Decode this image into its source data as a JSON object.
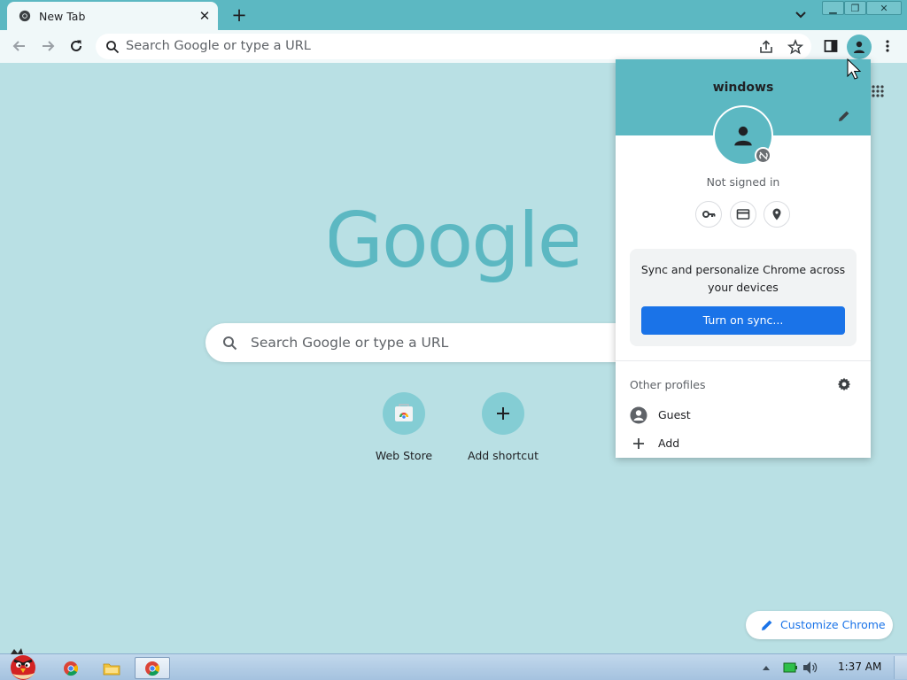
{
  "tab": {
    "title": "New Tab",
    "close_glyph": "✕",
    "favicon": "chrome-icon"
  },
  "new_tab": {
    "glyph": "+"
  },
  "window_controls": {
    "minimize": "▁",
    "maximize": "❐",
    "close": "✕"
  },
  "toolbar": {
    "omnibox_placeholder": "Search Google or type a URL"
  },
  "ntp": {
    "search_placeholder": "Search Google or type a URL",
    "shortcuts": [
      {
        "label": "Web Store",
        "icon": "web-store-icon"
      },
      {
        "label": "Add shortcut",
        "icon": "plus-icon"
      }
    ],
    "customize_label": "Customize Chrome"
  },
  "profile_menu": {
    "name": "windows",
    "status": "Not signed in",
    "sync_text": "Sync and personalize Chrome across your devices",
    "sync_button": "Turn on sync...",
    "other_profiles_label": "Other profiles",
    "profiles": [
      {
        "label": "Guest",
        "icon": "guest-avatar-icon"
      },
      {
        "label": "Add",
        "icon": "plus-icon"
      }
    ]
  },
  "taskbar": {
    "clock": "1:37 AM"
  },
  "colors": {
    "frame": "#5cb8c2",
    "page_background": "#b9e0e4",
    "google_logo": "#5cb8c2",
    "sync_button": "#1a73e8",
    "accent_text": "#1a73e8"
  }
}
